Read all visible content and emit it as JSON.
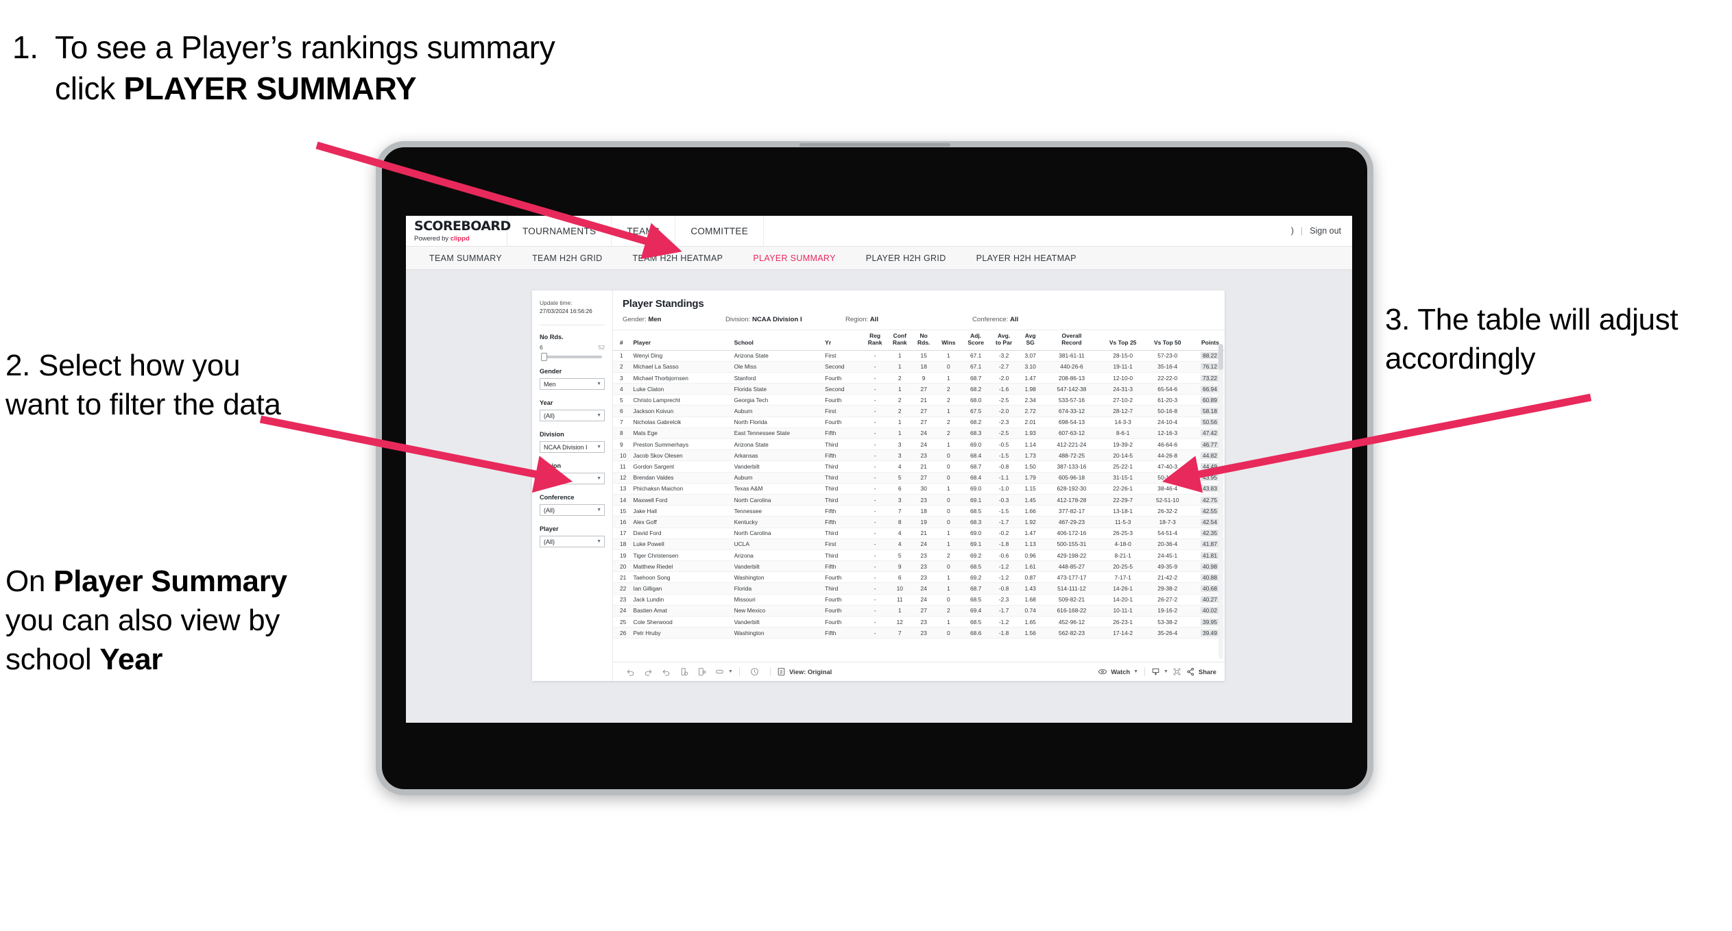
{
  "annotations": {
    "step1_number": "1.",
    "step1_text_a": "To see a Player’s rankings summary click ",
    "step1_text_b": "PLAYER SUMMARY",
    "step2_text": "2. Select how you want to filter the data",
    "step2b_a": "On ",
    "step2b_b": "Player Summary",
    "step2b_c": " you can also view by school ",
    "step2b_d": "Year",
    "step3_text": "3. The table will adjust accordingly"
  },
  "app": {
    "logo_main": "SCOREBOARD",
    "logo_sub_prefix": "Powered by ",
    "logo_sub_brand": "clippd",
    "top_nav": [
      "TOURNAMENTS",
      "TEAMS",
      "COMMITTEE"
    ],
    "user_initial": ")",
    "separator": "|",
    "sign_out": "Sign out",
    "sub_nav": [
      {
        "label": "TEAM SUMMARY",
        "active": false
      },
      {
        "label": "TEAM H2H GRID",
        "active": false
      },
      {
        "label": "TEAM H2H HEATMAP",
        "active": false
      },
      {
        "label": "PLAYER SUMMARY",
        "active": true
      },
      {
        "label": "PLAYER H2H GRID",
        "active": false
      },
      {
        "label": "PLAYER H2H HEATMAP",
        "active": false
      }
    ],
    "accent_color": "#e8295b"
  },
  "filters": {
    "update_label": "Update time:",
    "update_value": "27/03/2024 16:56:26",
    "no_rds_label": "No Rds.",
    "no_rds_min": "6",
    "no_rds_max": "52",
    "controls": [
      {
        "label": "Gender",
        "value": "Men"
      },
      {
        "label": "Year",
        "value": "(All)"
      },
      {
        "label": "Division",
        "value": "NCAA Division I"
      },
      {
        "label": "Region",
        "value": "N/A"
      },
      {
        "label": "Conference",
        "value": "(All)"
      },
      {
        "label": "Player",
        "value": "(All)"
      }
    ]
  },
  "viz": {
    "title": "Player Standings",
    "meta": [
      {
        "label": "Gender:",
        "value": "Men"
      },
      {
        "label": "Division:",
        "value": "NCAA Division I"
      },
      {
        "label": "Region:",
        "value": "All"
      },
      {
        "label": "Conference:",
        "value": "All"
      }
    ]
  },
  "table": {
    "headers": [
      "#",
      "Player",
      "School",
      "Yr",
      "Reg Rank",
      "Conf Rank",
      "No Rds.",
      "Wins",
      "Adj. Score",
      "Avg. to Par",
      "Avg SG",
      "Overall Record",
      "Vs Top 25",
      "Vs Top 50",
      "Points"
    ],
    "headers_two_line": [
      {
        "l1": "#",
        "l2": ""
      },
      {
        "l1": "Player",
        "l2": ""
      },
      {
        "l1": "School",
        "l2": ""
      },
      {
        "l1": "Yr",
        "l2": ""
      },
      {
        "l1": "Reg",
        "l2": "Rank"
      },
      {
        "l1": "Conf",
        "l2": "Rank"
      },
      {
        "l1": "No",
        "l2": "Rds."
      },
      {
        "l1": "Wins",
        "l2": ""
      },
      {
        "l1": "Adj.",
        "l2": "Score"
      },
      {
        "l1": "Avg.",
        "l2": "to Par"
      },
      {
        "l1": "Avg",
        "l2": "SG"
      },
      {
        "l1": "Overall",
        "l2": "Record"
      },
      {
        "l1": "Vs Top 25",
        "l2": ""
      },
      {
        "l1": "Vs Top 50",
        "l2": ""
      },
      {
        "l1": "Points",
        "l2": ""
      }
    ],
    "rows": [
      [
        "1",
        "Wenyi Ding",
        "Arizona State",
        "First",
        "-",
        "1",
        "15",
        "1",
        "67.1",
        "-3.2",
        "3.07",
        "381-61-11",
        "28-15-0",
        "57-23-0",
        "88.22"
      ],
      [
        "2",
        "Michael La Sasso",
        "Ole Miss",
        "Second",
        "-",
        "1",
        "18",
        "0",
        "67.1",
        "-2.7",
        "3.10",
        "440-26-6",
        "19-11-1",
        "35-16-4",
        "76.12"
      ],
      [
        "3",
        "Michael Thorbjornsen",
        "Stanford",
        "Fourth",
        "-",
        "2",
        "9",
        "1",
        "68.7",
        "-2.0",
        "1.47",
        "208-86-13",
        "12-10-0",
        "22-22-0",
        "73.22"
      ],
      [
        "4",
        "Luke Claton",
        "Florida State",
        "Second",
        "-",
        "1",
        "27",
        "2",
        "68.2",
        "-1.6",
        "1.98",
        "547-142-38",
        "24-31-3",
        "65-54-6",
        "66.94"
      ],
      [
        "5",
        "Christo Lamprecht",
        "Georgia Tech",
        "Fourth",
        "-",
        "2",
        "21",
        "2",
        "68.0",
        "-2.5",
        "2.34",
        "533-57-16",
        "27-10-2",
        "61-20-3",
        "60.89"
      ],
      [
        "6",
        "Jackson Koivun",
        "Auburn",
        "First",
        "-",
        "2",
        "27",
        "1",
        "67.5",
        "-2.0",
        "2.72",
        "674-33-12",
        "28-12-7",
        "50-16-8",
        "58.18"
      ],
      [
        "7",
        "Nicholas Gabrelcik",
        "North Florida",
        "Fourth",
        "-",
        "1",
        "27",
        "2",
        "68.2",
        "-2.3",
        "2.01",
        "698-54-13",
        "14-3-3",
        "24-10-4",
        "50.56"
      ],
      [
        "8",
        "Mats Ege",
        "East Tennessee State",
        "Fifth",
        "-",
        "1",
        "24",
        "2",
        "68.3",
        "-2.5",
        "1.93",
        "607-63-12",
        "8-6-1",
        "12-16-3",
        "47.42"
      ],
      [
        "9",
        "Preston Summerhays",
        "Arizona State",
        "Third",
        "-",
        "3",
        "24",
        "1",
        "69.0",
        "-0.5",
        "1.14",
        "412-221-24",
        "19-39-2",
        "46-64-6",
        "46.77"
      ],
      [
        "10",
        "Jacob Skov Olesen",
        "Arkansas",
        "Fifth",
        "-",
        "3",
        "23",
        "0",
        "68.4",
        "-1.5",
        "1.73",
        "488-72-25",
        "20-14-5",
        "44-26-8",
        "44.82"
      ],
      [
        "11",
        "Gordon Sargent",
        "Vanderbilt",
        "Third",
        "-",
        "4",
        "21",
        "0",
        "68.7",
        "-0.8",
        "1.50",
        "387-133-16",
        "25-22-1",
        "47-40-3",
        "44.49"
      ],
      [
        "12",
        "Brendan Valdes",
        "Auburn",
        "Third",
        "-",
        "5",
        "27",
        "0",
        "68.4",
        "-1.1",
        "1.79",
        "605-96-18",
        "31-15-1",
        "50-18-5",
        "43.95"
      ],
      [
        "13",
        "Phichaksn Maichon",
        "Texas A&M",
        "Third",
        "-",
        "6",
        "30",
        "1",
        "69.0",
        "-1.0",
        "1.15",
        "628-192-30",
        "22-26-1",
        "38-46-4",
        "43.83"
      ],
      [
        "14",
        "Maxwell Ford",
        "North Carolina",
        "Third",
        "-",
        "3",
        "23",
        "0",
        "69.1",
        "-0.3",
        "1.45",
        "412-178-28",
        "22-29-7",
        "52-51-10",
        "42.75"
      ],
      [
        "15",
        "Jake Hall",
        "Tennessee",
        "Fifth",
        "-",
        "7",
        "18",
        "0",
        "68.5",
        "-1.5",
        "1.66",
        "377-82-17",
        "13-18-1",
        "26-32-2",
        "42.55"
      ],
      [
        "16",
        "Alex Goff",
        "Kentucky",
        "Fifth",
        "-",
        "8",
        "19",
        "0",
        "68.3",
        "-1.7",
        "1.92",
        "467-29-23",
        "11-5-3",
        "18-7-3",
        "42.54"
      ],
      [
        "17",
        "David Ford",
        "North Carolina",
        "Third",
        "-",
        "4",
        "21",
        "1",
        "69.0",
        "-0.2",
        "1.47",
        "406-172-16",
        "26-25-3",
        "54-51-4",
        "42.35"
      ],
      [
        "18",
        "Luke Powell",
        "UCLA",
        "First",
        "-",
        "4",
        "24",
        "1",
        "69.1",
        "-1.8",
        "1.13",
        "500-155-31",
        "4-18-0",
        "20-36-4",
        "41.87"
      ],
      [
        "19",
        "Tiger Christensen",
        "Arizona",
        "Third",
        "-",
        "5",
        "23",
        "2",
        "69.2",
        "-0.6",
        "0.96",
        "429-198-22",
        "8-21-1",
        "24-45-1",
        "41.81"
      ],
      [
        "20",
        "Matthew Riedel",
        "Vanderbilt",
        "Fifth",
        "-",
        "9",
        "23",
        "0",
        "68.5",
        "-1.2",
        "1.61",
        "448-85-27",
        "20-25-5",
        "49-35-9",
        "40.98"
      ],
      [
        "21",
        "Taehoon Song",
        "Washington",
        "Fourth",
        "-",
        "6",
        "23",
        "1",
        "69.2",
        "-1.2",
        "0.87",
        "473-177-17",
        "7-17-1",
        "21-42-2",
        "40.88"
      ],
      [
        "22",
        "Ian Gilligan",
        "Florida",
        "Third",
        "-",
        "10",
        "24",
        "1",
        "68.7",
        "-0.8",
        "1.43",
        "514-111-12",
        "14-26-1",
        "29-38-2",
        "40.68"
      ],
      [
        "23",
        "Jack Lundin",
        "Missouri",
        "Fourth",
        "-",
        "11",
        "24",
        "0",
        "68.5",
        "-2.3",
        "1.68",
        "509-82-21",
        "14-20-1",
        "26-27-2",
        "40.27"
      ],
      [
        "24",
        "Bastien Amat",
        "New Mexico",
        "Fourth",
        "-",
        "1",
        "27",
        "2",
        "69.4",
        "-1.7",
        "0.74",
        "616-168-22",
        "10-11-1",
        "19-16-2",
        "40.02"
      ],
      [
        "25",
        "Cole Sherwood",
        "Vanderbilt",
        "Fourth",
        "-",
        "12",
        "23",
        "1",
        "68.5",
        "-1.2",
        "1.65",
        "452-96-12",
        "26-23-1",
        "53-38-2",
        "39.95"
      ],
      [
        "26",
        "Petr Hruby",
        "Washington",
        "Fifth",
        "-",
        "7",
        "23",
        "0",
        "68.6",
        "-1.8",
        "1.56",
        "562-82-23",
        "17-14-2",
        "35-26-4",
        "39.49"
      ]
    ]
  },
  "toolbar": {
    "view_label": "View: Original",
    "watch_label": "Watch",
    "share_label": "Share"
  }
}
